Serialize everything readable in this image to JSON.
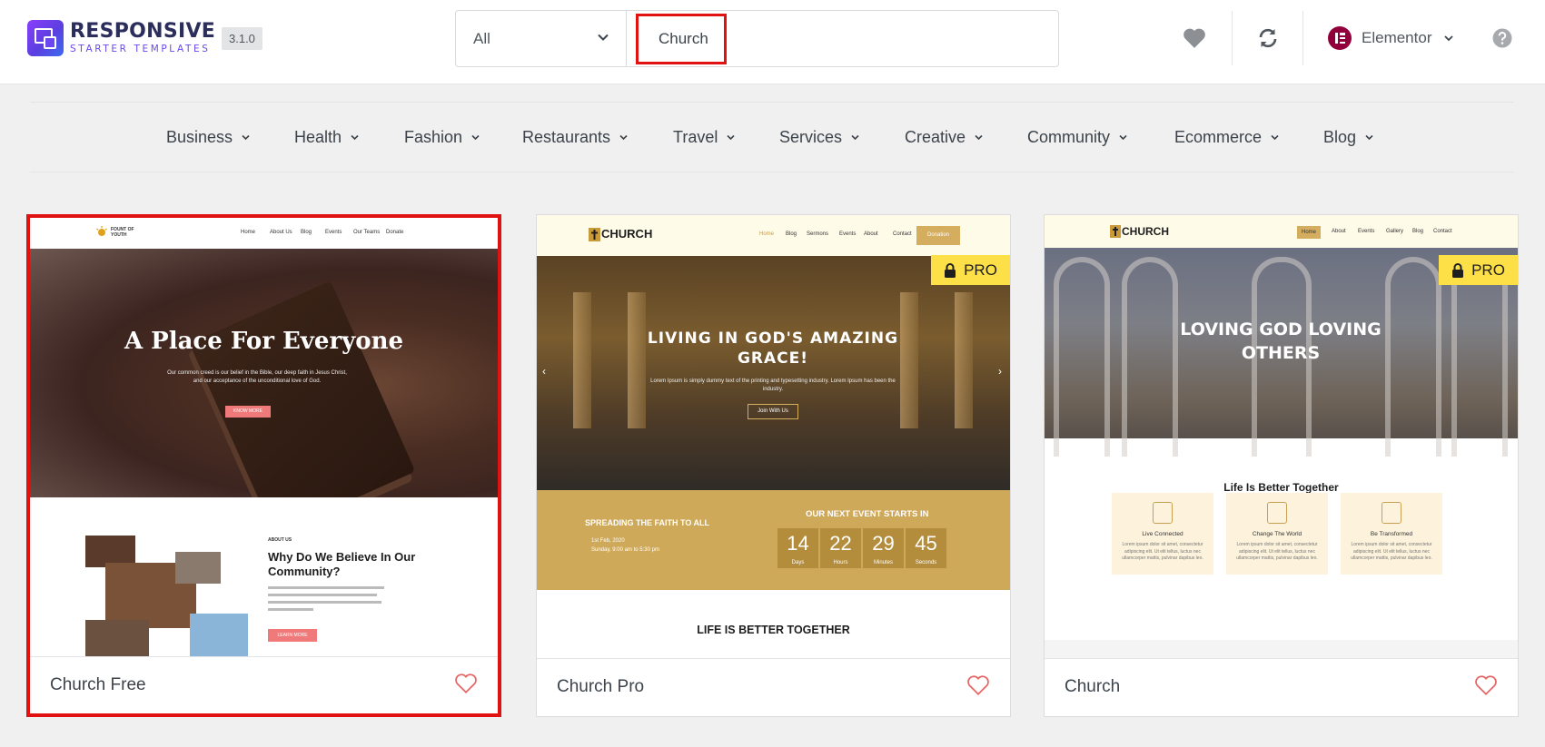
{
  "brand": {
    "line1": "RESPONSIVE",
    "line2": "STARTER TEMPLATES",
    "version": "3.1.0"
  },
  "search": {
    "type_selected": "All",
    "query": "Church"
  },
  "builder": {
    "label": "Elementor"
  },
  "header_icons": [
    "heart-icon",
    "sync-icon",
    "help-icon"
  ],
  "categories": [
    "Business",
    "Health",
    "Fashion",
    "Restaurants",
    "Travel",
    "Services",
    "Creative",
    "Community",
    "Ecommerce",
    "Blog"
  ],
  "colors": {
    "selection": "#e01212",
    "heart": "#e66565",
    "pro_badge": "#fde047",
    "brand_purple": "#6a47f0"
  },
  "cards": [
    {
      "title": "Church Free",
      "pro": false,
      "selected": true,
      "preview": {
        "logo": "FOUNT OF YOUTH",
        "nav": [
          "Home",
          "About Us",
          "Blog",
          "Events",
          "Our Teams",
          "Donate"
        ],
        "hero_title": "A Place For Everyone",
        "hero_text": "Our common creed is our belief in the Bible, our deep faith in Jesus Christ, and our acceptance of the unconditional love of God.",
        "hero_button": "KNOW MORE",
        "section_kicker": "ABOUT US",
        "section_title": "Why Do We Believe In Our Community?",
        "section_button": "LEARN MORE"
      }
    },
    {
      "title": "Church Pro",
      "pro": true,
      "pro_label": "PRO",
      "preview": {
        "logo": "CHURCH",
        "nav": [
          "Home",
          "Blog",
          "Sermons",
          "Events",
          "About",
          "Contact"
        ],
        "nav_button": "Donation",
        "hero_title": "LIVING IN GOD'S AMAZING GRACE!",
        "hero_text": "Lorem Ipsum is simply dummy text of the printing and typesetting industry. Lorem Ipsum has been the industry.",
        "hero_button": "Join With Us",
        "band_left": "SPREADING THE FAITH TO ALL",
        "band_date": "1st Feb, 2020",
        "band_time": "Sunday, 9:00 am to 5:30 pm",
        "band_right": "OUR NEXT EVENT STARTS IN",
        "countdown": [
          {
            "value": "14",
            "unit": "Days"
          },
          {
            "value": "22",
            "unit": "Hours"
          },
          {
            "value": "29",
            "unit": "Minutes"
          },
          {
            "value": "45",
            "unit": "Seconds"
          }
        ],
        "section_title": "LIFE IS BETTER TOGETHER"
      }
    },
    {
      "title": "Church",
      "pro": true,
      "pro_label": "PRO",
      "preview": {
        "logo": "CHURCH",
        "nav": [
          "Home",
          "About",
          "Events",
          "Gallery",
          "Blog",
          "Contact"
        ],
        "hero_title": "LOVING GOD LOVING OTHERS",
        "section_title": "Life Is Better Together",
        "features": [
          {
            "title": "Live Connected",
            "text": "Lorem ipsum dolor sit amet, consectetur adipiscing elit. Ut elit tellus, luctus nec ullamcorper mattis, pulvinar dapibus leo."
          },
          {
            "title": "Change The World",
            "text": "Lorem ipsum dolor sit amet, consectetur adipiscing elit. Ut elit tellus, luctus nec ullamcorper mattis, pulvinar dapibus leo."
          },
          {
            "title": "Be Transformed",
            "text": "Lorem ipsum dolor sit amet, consectetur adipiscing elit. Ut elit tellus, luctus nec ullamcorper mattis, pulvinar dapibus leo."
          }
        ]
      }
    }
  ]
}
